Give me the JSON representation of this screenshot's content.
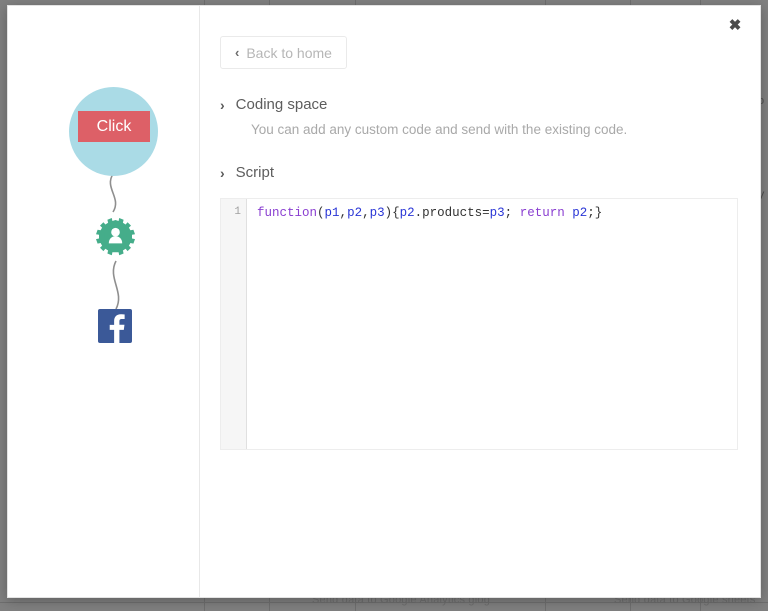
{
  "background": {
    "ghost_labels": [
      "Send data to Google Analytics glog",
      "Send data to Google sheets"
    ],
    "right_edge_labels": [
      "o",
      "V"
    ]
  },
  "modal": {
    "close_icon": "close-icon",
    "close_glyph": "✖"
  },
  "flow": {
    "nodes": [
      {
        "id": "click",
        "type": "trigger",
        "label": "Click",
        "circle_color": "#aadbe6",
        "button_color": "#dd6067"
      },
      {
        "id": "gear",
        "type": "action",
        "label": "gear-icon",
        "color": "#45ad8a"
      },
      {
        "id": "facebook",
        "type": "destination",
        "label": "facebook-icon",
        "color": "#3b5998"
      }
    ],
    "connector_color": "#8f8f8f"
  },
  "content": {
    "back_button": {
      "label": "Back to home",
      "chevron": "‹"
    },
    "sections": [
      {
        "chevron": "›",
        "title": "Coding space",
        "description": "You can add any custom code and send with the existing code."
      },
      {
        "chevron": "›",
        "title": "Script",
        "description": ""
      }
    ],
    "editor": {
      "line_number": "1",
      "code_raw": "function(p1,p2,p3){p2.products=p3; return p2;}",
      "tokens": [
        {
          "text": "function",
          "kind": "kw"
        },
        {
          "text": "(",
          "kind": "plain"
        },
        {
          "text": "p1",
          "kind": "var"
        },
        {
          "text": ",",
          "kind": "plain"
        },
        {
          "text": "p2",
          "kind": "var"
        },
        {
          "text": ",",
          "kind": "plain"
        },
        {
          "text": "p3",
          "kind": "var"
        },
        {
          "text": "){",
          "kind": "plain"
        },
        {
          "text": "p2",
          "kind": "var"
        },
        {
          "text": ".products=",
          "kind": "plain"
        },
        {
          "text": "p3",
          "kind": "var"
        },
        {
          "text": "; ",
          "kind": "plain"
        },
        {
          "text": "return",
          "kind": "kw"
        },
        {
          "text": " ",
          "kind": "plain"
        },
        {
          "text": "p2",
          "kind": "var"
        },
        {
          "text": ";}",
          "kind": "plain"
        }
      ]
    }
  }
}
